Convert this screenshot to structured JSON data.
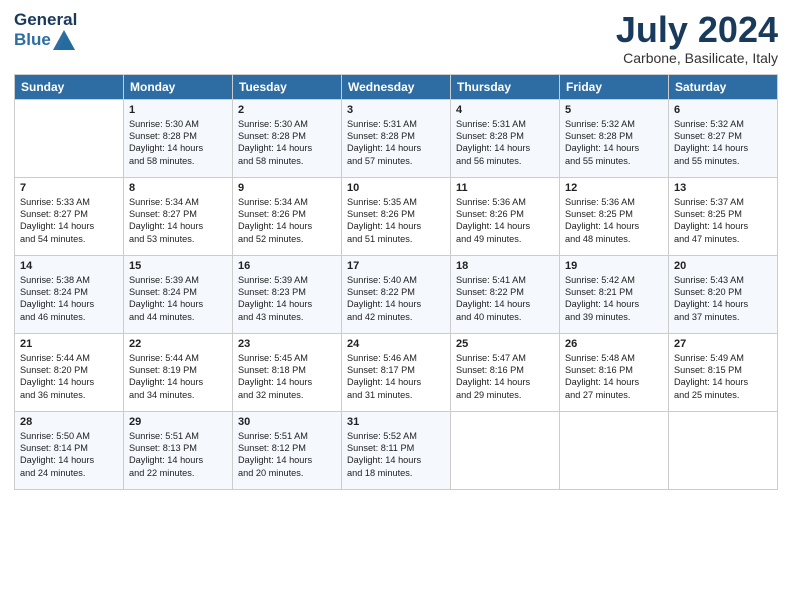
{
  "header": {
    "logo_line1": "General",
    "logo_line2": "Blue",
    "month": "July 2024",
    "location": "Carbone, Basilicate, Italy"
  },
  "days_of_week": [
    "Sunday",
    "Monday",
    "Tuesday",
    "Wednesday",
    "Thursday",
    "Friday",
    "Saturday"
  ],
  "weeks": [
    [
      {
        "day": "",
        "info": ""
      },
      {
        "day": "1",
        "info": "Sunrise: 5:30 AM\nSunset: 8:28 PM\nDaylight: 14 hours\nand 58 minutes."
      },
      {
        "day": "2",
        "info": "Sunrise: 5:30 AM\nSunset: 8:28 PM\nDaylight: 14 hours\nand 58 minutes."
      },
      {
        "day": "3",
        "info": "Sunrise: 5:31 AM\nSunset: 8:28 PM\nDaylight: 14 hours\nand 57 minutes."
      },
      {
        "day": "4",
        "info": "Sunrise: 5:31 AM\nSunset: 8:28 PM\nDaylight: 14 hours\nand 56 minutes."
      },
      {
        "day": "5",
        "info": "Sunrise: 5:32 AM\nSunset: 8:28 PM\nDaylight: 14 hours\nand 55 minutes."
      },
      {
        "day": "6",
        "info": "Sunrise: 5:32 AM\nSunset: 8:27 PM\nDaylight: 14 hours\nand 55 minutes."
      }
    ],
    [
      {
        "day": "7",
        "info": "Sunrise: 5:33 AM\nSunset: 8:27 PM\nDaylight: 14 hours\nand 54 minutes."
      },
      {
        "day": "8",
        "info": "Sunrise: 5:34 AM\nSunset: 8:27 PM\nDaylight: 14 hours\nand 53 minutes."
      },
      {
        "day": "9",
        "info": "Sunrise: 5:34 AM\nSunset: 8:26 PM\nDaylight: 14 hours\nand 52 minutes."
      },
      {
        "day": "10",
        "info": "Sunrise: 5:35 AM\nSunset: 8:26 PM\nDaylight: 14 hours\nand 51 minutes."
      },
      {
        "day": "11",
        "info": "Sunrise: 5:36 AM\nSunset: 8:26 PM\nDaylight: 14 hours\nand 49 minutes."
      },
      {
        "day": "12",
        "info": "Sunrise: 5:36 AM\nSunset: 8:25 PM\nDaylight: 14 hours\nand 48 minutes."
      },
      {
        "day": "13",
        "info": "Sunrise: 5:37 AM\nSunset: 8:25 PM\nDaylight: 14 hours\nand 47 minutes."
      }
    ],
    [
      {
        "day": "14",
        "info": "Sunrise: 5:38 AM\nSunset: 8:24 PM\nDaylight: 14 hours\nand 46 minutes."
      },
      {
        "day": "15",
        "info": "Sunrise: 5:39 AM\nSunset: 8:24 PM\nDaylight: 14 hours\nand 44 minutes."
      },
      {
        "day": "16",
        "info": "Sunrise: 5:39 AM\nSunset: 8:23 PM\nDaylight: 14 hours\nand 43 minutes."
      },
      {
        "day": "17",
        "info": "Sunrise: 5:40 AM\nSunset: 8:22 PM\nDaylight: 14 hours\nand 42 minutes."
      },
      {
        "day": "18",
        "info": "Sunrise: 5:41 AM\nSunset: 8:22 PM\nDaylight: 14 hours\nand 40 minutes."
      },
      {
        "day": "19",
        "info": "Sunrise: 5:42 AM\nSunset: 8:21 PM\nDaylight: 14 hours\nand 39 minutes."
      },
      {
        "day": "20",
        "info": "Sunrise: 5:43 AM\nSunset: 8:20 PM\nDaylight: 14 hours\nand 37 minutes."
      }
    ],
    [
      {
        "day": "21",
        "info": "Sunrise: 5:44 AM\nSunset: 8:20 PM\nDaylight: 14 hours\nand 36 minutes."
      },
      {
        "day": "22",
        "info": "Sunrise: 5:44 AM\nSunset: 8:19 PM\nDaylight: 14 hours\nand 34 minutes."
      },
      {
        "day": "23",
        "info": "Sunrise: 5:45 AM\nSunset: 8:18 PM\nDaylight: 14 hours\nand 32 minutes."
      },
      {
        "day": "24",
        "info": "Sunrise: 5:46 AM\nSunset: 8:17 PM\nDaylight: 14 hours\nand 31 minutes."
      },
      {
        "day": "25",
        "info": "Sunrise: 5:47 AM\nSunset: 8:16 PM\nDaylight: 14 hours\nand 29 minutes."
      },
      {
        "day": "26",
        "info": "Sunrise: 5:48 AM\nSunset: 8:16 PM\nDaylight: 14 hours\nand 27 minutes."
      },
      {
        "day": "27",
        "info": "Sunrise: 5:49 AM\nSunset: 8:15 PM\nDaylight: 14 hours\nand 25 minutes."
      }
    ],
    [
      {
        "day": "28",
        "info": "Sunrise: 5:50 AM\nSunset: 8:14 PM\nDaylight: 14 hours\nand 24 minutes."
      },
      {
        "day": "29",
        "info": "Sunrise: 5:51 AM\nSunset: 8:13 PM\nDaylight: 14 hours\nand 22 minutes."
      },
      {
        "day": "30",
        "info": "Sunrise: 5:51 AM\nSunset: 8:12 PM\nDaylight: 14 hours\nand 20 minutes."
      },
      {
        "day": "31",
        "info": "Sunrise: 5:52 AM\nSunset: 8:11 PM\nDaylight: 14 hours\nand 18 minutes."
      },
      {
        "day": "",
        "info": ""
      },
      {
        "day": "",
        "info": ""
      },
      {
        "day": "",
        "info": ""
      }
    ]
  ]
}
